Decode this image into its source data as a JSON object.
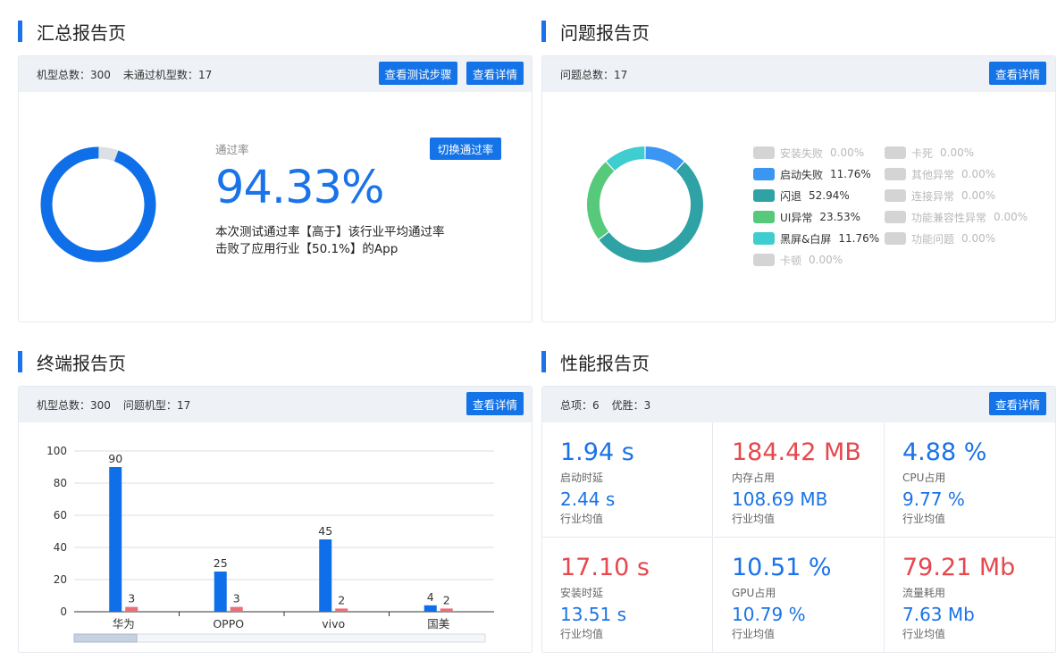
{
  "summary": {
    "title": "汇总报告页",
    "total_label": "机型总数：",
    "total_value": "300",
    "failed_label": "未通过机型数：",
    "failed_value": "17",
    "btn_steps": "查看测试步骤",
    "btn_detail": "查看详情",
    "pass_rate_label": "通过率",
    "switch_btn": "切换通过率",
    "pass_rate": "94.33%",
    "pass_rate_value": 94.33,
    "line1": "本次测试通过率【高于】该行业平均通过率",
    "line2": "击败了应用行业【50.1%】的App",
    "ring_color": "#0e6fe8",
    "ring_rest_color": "#dcdfe4"
  },
  "issues": {
    "title": "问题报告页",
    "total_label": "问题总数：",
    "total_value": "17",
    "btn_detail": "查看详情",
    "legend_left": [
      {
        "label": "安装失败",
        "pct": "0.00%",
        "color": "#d4d4d4",
        "active": false
      },
      {
        "label": "启动失败",
        "pct": "11.76%",
        "color": "#3a96f2",
        "active": true
      },
      {
        "label": "闪退",
        "pct": "52.94%",
        "color": "#2fa2a6",
        "active": true
      },
      {
        "label": "UI异常",
        "pct": "23.53%",
        "color": "#56c97a",
        "active": true
      },
      {
        "label": "黑屏&白屏",
        "pct": "11.76%",
        "color": "#3fcdd0",
        "active": true
      },
      {
        "label": "卡顿",
        "pct": "0.00%",
        "color": "#d4d4d4",
        "active": false
      }
    ],
    "legend_right": [
      {
        "label": "卡死",
        "pct": "0.00%",
        "color": "#d4d4d4",
        "active": false
      },
      {
        "label": "其他异常",
        "pct": "0.00%",
        "color": "#d4d4d4",
        "active": false
      },
      {
        "label": "连接异常",
        "pct": "0.00%",
        "color": "#d4d4d4",
        "active": false
      },
      {
        "label": "功能兼容性异常",
        "pct": "0.00%",
        "color": "#d4d4d4",
        "active": false
      },
      {
        "label": "功能问题",
        "pct": "0.00%",
        "color": "#d4d4d4",
        "active": false
      }
    ]
  },
  "terminal": {
    "title": "终端报告页",
    "total_label": "机型总数：",
    "total_value": "300",
    "problem_label": "问题机型：",
    "problem_value": "17",
    "btn_detail": "查看详情"
  },
  "performance": {
    "title": "性能报告页",
    "total_label": "总项：",
    "total_value": "6",
    "better_label": "优胜：",
    "better_value": "3",
    "btn_detail": "查看详情",
    "avg_label": "行业均值",
    "cells": [
      {
        "value": "1.94 s",
        "label": "启动时延",
        "avg": "2.44 s",
        "color": "blue"
      },
      {
        "value": "184.42 MB",
        "label": "内存占用",
        "avg": "108.69 MB",
        "color": "red"
      },
      {
        "value": "4.88 %",
        "label": "CPU占用",
        "avg": "9.77 %",
        "color": "blue"
      },
      {
        "value": "17.10 s",
        "label": "安装时延",
        "avg": "13.51 s",
        "color": "red"
      },
      {
        "value": "10.51 %",
        "label": "GPU占用",
        "avg": "10.79 %",
        "color": "blue"
      },
      {
        "value": "79.21 Mb",
        "label": "流量耗用",
        "avg": "7.63 Mb",
        "color": "red"
      }
    ]
  },
  "chart_data": [
    {
      "type": "pie",
      "categories": [
        "通过",
        "未通过"
      ],
      "values": [
        94.33,
        5.67
      ],
      "colors": [
        "#0e6fe8",
        "#dcdfe4"
      ]
    },
    {
      "type": "pie",
      "categories": [
        "启动失败",
        "闪退",
        "UI异常",
        "黑屏&白屏"
      ],
      "values": [
        11.76,
        52.94,
        23.53,
        11.76
      ],
      "colors": [
        "#3a96f2",
        "#2fa2a6",
        "#56c97a",
        "#3fcdd0"
      ]
    },
    {
      "type": "bar",
      "categories": [
        "华为",
        "OPPO",
        "vivo",
        "国美"
      ],
      "series": [
        {
          "values": [
            90,
            25,
            45,
            4
          ],
          "color": "#0e6fe8"
        },
        {
          "values": [
            3,
            3,
            2,
            2
          ],
          "color": "#e8707a"
        }
      ],
      "yticks": [
        "0",
        "20",
        "40",
        "60",
        "80",
        "100"
      ],
      "ylim": [
        0,
        100
      ],
      "grid": true
    }
  ]
}
